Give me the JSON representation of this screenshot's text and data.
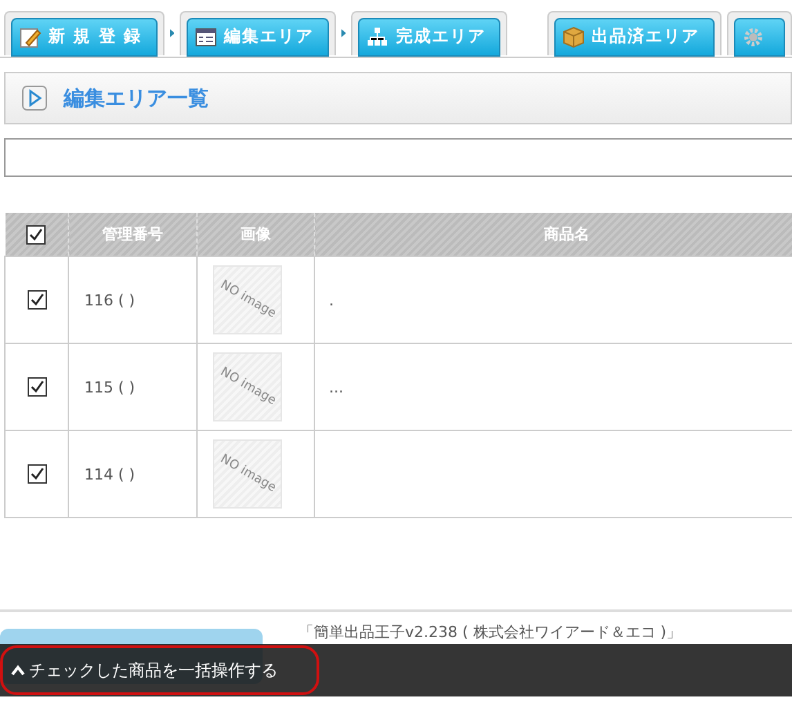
{
  "steps": [
    {
      "label": "新 規 登 録",
      "kind": "pencil"
    },
    {
      "label": "編集エリア",
      "kind": "list"
    },
    {
      "label": "完成エリア",
      "kind": "tree"
    }
  ],
  "tabs": [
    {
      "label": "出品済エリア",
      "kind": "box"
    },
    {
      "kind": "gear"
    }
  ],
  "panel": {
    "title": "編集エリア一覧"
  },
  "table": {
    "all_checked": true,
    "columns": [
      "管理番号",
      "画像",
      "商品名"
    ],
    "rows": [
      {
        "checked": true,
        "id": "116 (  )",
        "image": "NO image",
        "name": "."
      },
      {
        "checked": true,
        "id": "115 (  )",
        "image": "NO image",
        "name": "..."
      },
      {
        "checked": true,
        "id": "114 (  )",
        "image": "NO image"
      }
    ]
  },
  "footer": {
    "lines": [
      "「簡単出品王子v2.238 ( 株式会社ワイアード＆エコ )」"
    ]
  },
  "action_bar": {
    "label": "チェックした商品を一括操作する"
  }
}
